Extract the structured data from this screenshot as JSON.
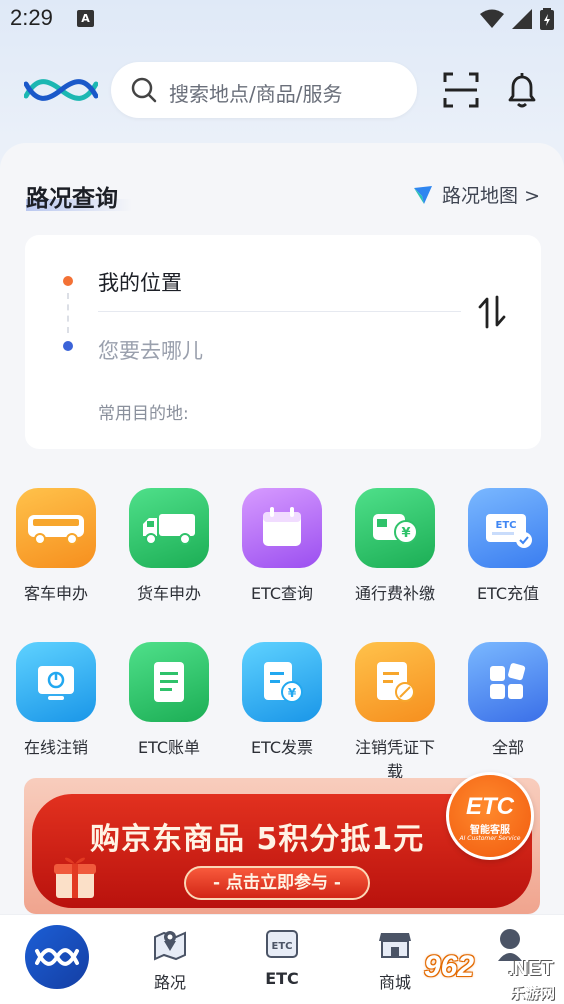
{
  "status_bar": {
    "time": "2:29",
    "indicator": "A"
  },
  "search": {
    "placeholder": "搜索地点/商品/服务"
  },
  "road": {
    "title": "路况查询",
    "map_link": "路况地图 >",
    "from": "我的位置",
    "to": "您要去哪儿",
    "common_dest": "常用目的地:"
  },
  "services": [
    {
      "label": "客车申办",
      "icon": "bus-icon",
      "color": "#f7a62c"
    },
    {
      "label": "货车申办",
      "icon": "truck-icon",
      "color": "#2fc26a"
    },
    {
      "label": "ETC查询",
      "icon": "calendar-icon",
      "color": "#b169f0"
    },
    {
      "label": "通行费补缴",
      "icon": "toll-payment-icon",
      "color": "#2fc26a"
    },
    {
      "label": "ETC充值",
      "icon": "etc-card-icon",
      "color": "#3f86f3"
    },
    {
      "label": "在线注销",
      "icon": "power-monitor-icon",
      "color": "#22a8f0"
    },
    {
      "label": "ETC账单",
      "icon": "bill-icon",
      "color": "#2fc26a"
    },
    {
      "label": "ETC发票",
      "icon": "invoice-icon",
      "color": "#22a8f0"
    },
    {
      "label": "注销凭证下载",
      "icon": "voucher-icon",
      "color": "#f7a62c"
    },
    {
      "label": "全部",
      "icon": "all-grid-icon",
      "color": "#3f7ef0"
    }
  ],
  "banner": {
    "title": "购京东商品 5积分抵1元",
    "cta": "- 点击立即参与 -",
    "badge_title": "ETC",
    "badge_sub": "智能客服",
    "badge_en": "AI Customer Service"
  },
  "bottom_nav": {
    "items": [
      {
        "label": "路况",
        "icon": "road-map-icon"
      },
      {
        "label": "ETC",
        "icon": "etc-icon"
      },
      {
        "label": "商城",
        "icon": "store-icon"
      }
    ]
  },
  "watermark": {
    "brand": "962",
    "domain": ".NET",
    "sub": "乐游网"
  }
}
